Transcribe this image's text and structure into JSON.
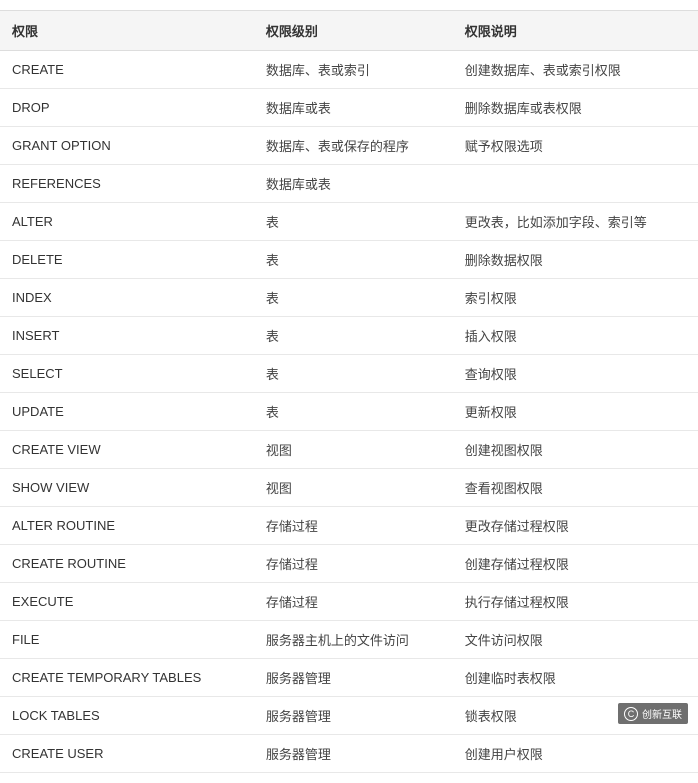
{
  "table": {
    "headers": [
      "权限",
      "权限级别",
      "权限说明"
    ],
    "rows": [
      {
        "privilege": "CREATE",
        "level": "数据库、表或索引",
        "description": "创建数据库、表或索引权限"
      },
      {
        "privilege": "DROP",
        "level": "数据库或表",
        "description": "删除数据库或表权限"
      },
      {
        "privilege": "GRANT OPTION",
        "level": "数据库、表或保存的程序",
        "description": "赋予权限选项"
      },
      {
        "privilege": "REFERENCES",
        "level": "数据库或表",
        "description": ""
      },
      {
        "privilege": "ALTER",
        "level": "表",
        "description": "更改表，比如添加字段、索引等"
      },
      {
        "privilege": "DELETE",
        "level": "表",
        "description": "删除数据权限"
      },
      {
        "privilege": "INDEX",
        "level": "表",
        "description": "索引权限"
      },
      {
        "privilege": "INSERT",
        "level": "表",
        "description": "插入权限"
      },
      {
        "privilege": "SELECT",
        "level": "表",
        "description": "查询权限"
      },
      {
        "privilege": "UPDATE",
        "level": "表",
        "description": "更新权限"
      },
      {
        "privilege": "CREATE VIEW",
        "level": "视图",
        "description": "创建视图权限"
      },
      {
        "privilege": "SHOW VIEW",
        "level": "视图",
        "description": "查看视图权限"
      },
      {
        "privilege": "ALTER ROUTINE",
        "level": "存储过程",
        "description": "更改存储过程权限"
      },
      {
        "privilege": "CREATE ROUTINE",
        "level": "存储过程",
        "description": "创建存储过程权限"
      },
      {
        "privilege": "EXECUTE",
        "level": "存储过程",
        "description": "执行存储过程权限"
      },
      {
        "privilege": "FILE",
        "level": "服务器主机上的文件访问",
        "description": "文件访问权限"
      },
      {
        "privilege": "CREATE TEMPORARY TABLES",
        "level": "服务器管理",
        "description": "创建临时表权限"
      },
      {
        "privilege": "LOCK TABLES",
        "level": "服务器管理",
        "description": "锁表权限"
      },
      {
        "privilege": "CREATE USER",
        "level": "服务器管理",
        "description": "创建用户权限"
      }
    ]
  },
  "watermark": {
    "text": "创新互联",
    "icon": "C"
  }
}
